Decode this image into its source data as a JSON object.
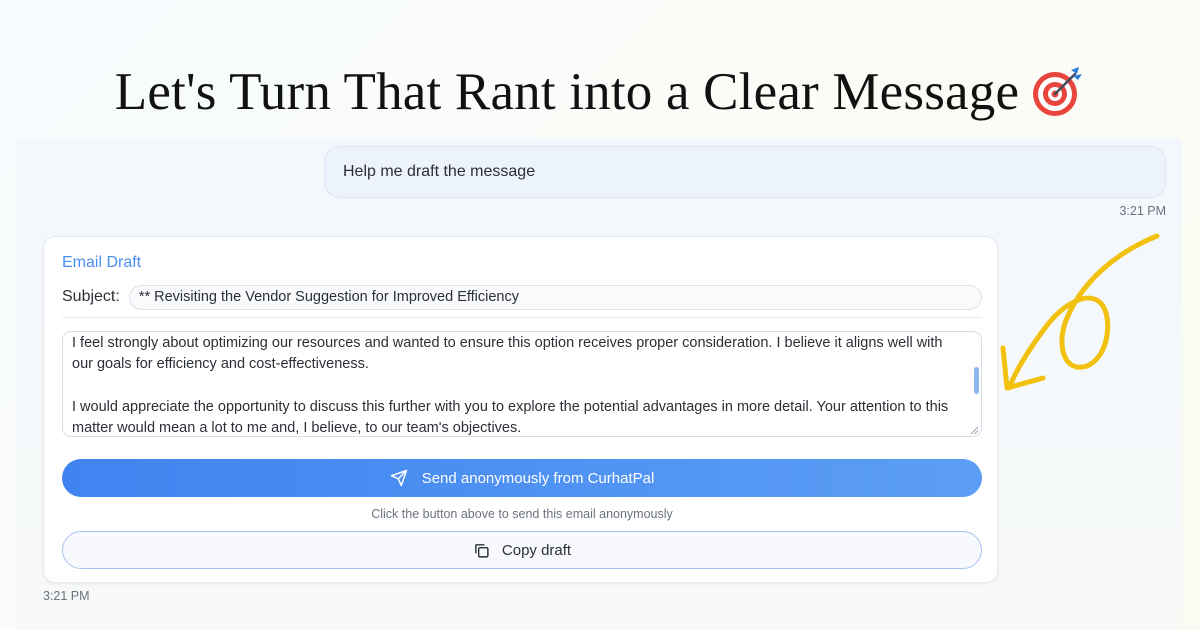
{
  "headline": {
    "text": "Let's Turn That Rant into a Clear Message",
    "icon": "direct-hit-target-icon"
  },
  "chat": {
    "user_message": "Help me draft the message",
    "user_timestamp": "3:21 PM",
    "bot_timestamp": "3:21 PM"
  },
  "email_card": {
    "title": "Email Draft",
    "subject_label": "Subject:",
    "subject_value": "** Revisiting the Vendor Suggestion for Improved Efficiency",
    "body": "I feel strongly about optimizing our resources and wanted to ensure this option receives proper consideration. I believe it aligns well with our goals for efficiency and cost-effectiveness.\n\nI would appreciate the opportunity to discuss this further with you to explore the potential advantages in more detail. Your attention to this matter would mean a lot to me and, I believe, to our team's objectives.",
    "send_label": "Send anonymously from CurhatPal",
    "send_icon": "paper-plane-icon",
    "send_hint": "Click the button above to send this email anonymously",
    "copy_label": "Copy draft",
    "copy_icon": "copy-icon"
  },
  "colors": {
    "accent_blue": "#4b8ef1",
    "send_gradient_start": "#3f84f0",
    "send_gradient_end": "#5c9ef5",
    "doodle_yellow": "#f2c10f"
  }
}
